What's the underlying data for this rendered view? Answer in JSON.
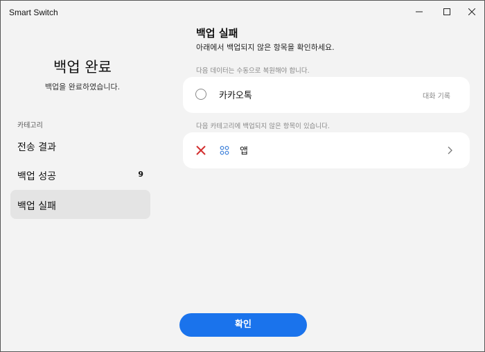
{
  "window": {
    "title": "Smart Switch"
  },
  "left": {
    "title": "백업 완료",
    "subtitle": "백업을 완료하였습니다.",
    "category_label": "카테고리",
    "nav": [
      {
        "label": "전송 결과",
        "count": ""
      },
      {
        "label": "백업 성공",
        "count": "9"
      },
      {
        "label": "백업 실패",
        "count": ""
      }
    ]
  },
  "right": {
    "title": "백업 실패",
    "subtitle": "아래에서 백업되지 않은 항목을 확인하세요.",
    "section1_label": "다음 데이터는 수동으로 복원해야 합니다.",
    "card1": {
      "title": "카카오톡",
      "right": "대화 기록"
    },
    "section2_label": "다음 카테고리에 백업되지 않은 항목이 있습니다.",
    "card2": {
      "title": "앱"
    }
  },
  "footer": {
    "confirm_label": "확인"
  },
  "colors": {
    "accent": "#1a73ec",
    "fail": "#d32f2f",
    "apps_icon": "#3b7fd9"
  }
}
